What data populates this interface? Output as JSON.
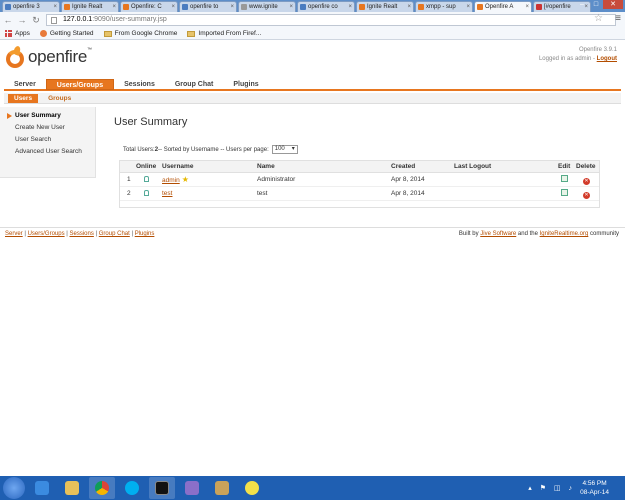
{
  "browser": {
    "tabs": [
      {
        "label": "openfire 3",
        "active": false
      },
      {
        "label": "Ignite Realt",
        "active": false
      },
      {
        "label": "Openfire: C",
        "active": false
      },
      {
        "label": "openfire to",
        "active": false
      },
      {
        "label": "www.ignite",
        "active": false
      },
      {
        "label": "openfire co",
        "active": false
      },
      {
        "label": "Ignite Realt",
        "active": false
      },
      {
        "label": "xmpp - sup",
        "active": false
      },
      {
        "label": "Openfire A",
        "active": true
      },
      {
        "label": "[#openfire",
        "active": false
      }
    ],
    "url_host": "127.0.0.1",
    "url_path": ":9090/user-summary.jsp",
    "bookmarks": [
      "Apps",
      "Getting Started",
      "From Google Chrome",
      "Imported From Firef..."
    ]
  },
  "header": {
    "logo_text": "openfire",
    "version": "Openfire 3.9.1",
    "login_prefix": "Logged in as admin - ",
    "logout_label": "Logout"
  },
  "mainnav": [
    "Server",
    "Users/Groups",
    "Sessions",
    "Group Chat",
    "Plugins"
  ],
  "mainnav_active": 1,
  "subnav": [
    "Users",
    "Groups"
  ],
  "sidebar": [
    "User Summary",
    "Create New User",
    "User Search",
    "Advanced User Search"
  ],
  "page": {
    "title": "User Summary",
    "totals_prefix": "Total Users: ",
    "total_count": "2",
    "totals_suffix": " -- Sorted by Username -- Users per page:",
    "per_page": "100"
  },
  "table": {
    "columns": [
      "Online",
      "Username",
      "Name",
      "Created",
      "Last Logout",
      "Edit",
      "Delete"
    ],
    "rows": [
      {
        "num": "1",
        "username": "admin",
        "name": "Administrator",
        "created": "Apr 8, 2014",
        "last_logout": ""
      },
      {
        "num": "2",
        "username": "test",
        "name": "test",
        "created": "Apr 8, 2014",
        "last_logout": ""
      }
    ]
  },
  "footer": {
    "links": [
      "Server",
      "Users/Groups",
      "Sessions",
      "Group Chat",
      "Plugins"
    ],
    "built_prefix": "Built by ",
    "jive": "Jive Software",
    "and": " and the ",
    "ignite": "IgniteRealtime.org",
    "suffix": " community"
  },
  "taskbar": {
    "time": "4:56 PM",
    "date": "08-Apr-14"
  }
}
